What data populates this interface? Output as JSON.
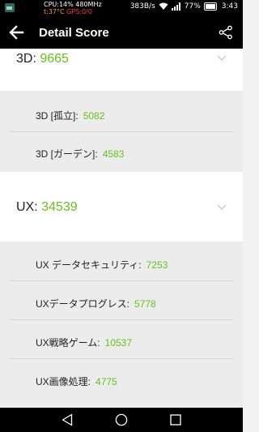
{
  "statusbar": {
    "cpu": "CPU:14% 480MHz",
    "temp": "t:37°C",
    "gps": "GPS:0/0",
    "net_speed": "383B/s",
    "battery": "77%",
    "time": "3:43"
  },
  "appbar": {
    "title": "Detail Score"
  },
  "sections": {
    "three_d": {
      "label": "3D:",
      "score": "9665",
      "items": [
        {
          "label": "3D [孤立]:",
          "score": "5082"
        },
        {
          "label": "3D [ガーデン]:",
          "score": "4583"
        }
      ]
    },
    "ux": {
      "label": "UX:",
      "score": "34539",
      "items": [
        {
          "label": "UX データセキュリティ:",
          "score": "7253"
        },
        {
          "label": "UXデータプログレス:",
          "score": "5778"
        },
        {
          "label": "UX戦略ゲーム:",
          "score": "10537"
        },
        {
          "label": "UX画像処理:",
          "score": "4775"
        }
      ]
    }
  },
  "colors": {
    "accent_green": "#66c21f",
    "bar_black": "#000000",
    "sub_bg": "#ececec"
  }
}
